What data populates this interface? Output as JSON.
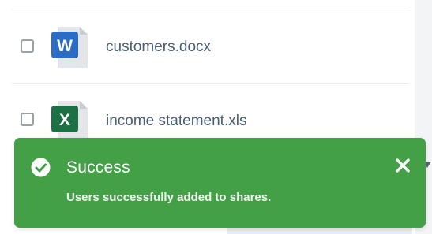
{
  "files": [
    {
      "name": "customers.docx",
      "icon": "word-document-icon",
      "icon_letter": "W",
      "icon_color": "#2b6cc4",
      "checked": false
    },
    {
      "name": "income statement.xls",
      "icon": "excel-spreadsheet-icon",
      "icon_letter": "X",
      "icon_color": "#1d7044",
      "checked": false
    }
  ],
  "toast": {
    "status": "success",
    "icon": "check-circle-icon",
    "title": "Success",
    "message": "Users successfully added to shares.",
    "close_icon": "close-icon",
    "color": "#43a047"
  }
}
